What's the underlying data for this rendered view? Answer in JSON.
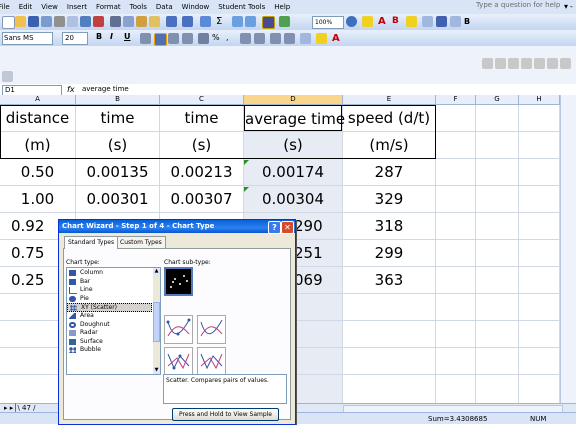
{
  "menu": [
    "File",
    "Edit",
    "View",
    "Insert",
    "Format",
    "Tools",
    "Data",
    "Window",
    "Student Tools",
    "Help"
  ],
  "help_box": "Type a question for help",
  "toolbar": {
    "zoom": "100%",
    "font_name": "Sans MS",
    "font_size": "20",
    "bold": "B",
    "italic": "I",
    "underline": "U"
  },
  "formula_bar": {
    "name_box": "D1",
    "fx": "fx",
    "content": "average time"
  },
  "columns": [
    "A",
    "B",
    "C",
    "D",
    "E",
    "F",
    "G",
    "H"
  ],
  "sheet": {
    "headers": [
      [
        "distance",
        "time",
        "time",
        "average time",
        "speed (d/t)"
      ],
      [
        "(m)",
        "(s)",
        "(s)",
        "(s)",
        "(m/s)"
      ]
    ],
    "rows": [
      [
        "0.50",
        "0.00135",
        "0.00213",
        "0.00174",
        "287"
      ],
      [
        "1.00",
        "0.00301",
        "0.00307",
        "0.00304",
        "329"
      ],
      [
        "0.92",
        "",
        "",
        "290",
        "318"
      ],
      [
        "0.75",
        "",
        "",
        "251",
        "299"
      ],
      [
        "0.25",
        "",
        "",
        "069",
        "363"
      ]
    ]
  },
  "sheet_tabs": {
    "nav": "▸ ▸│\\ 47 /"
  },
  "statusbar": {
    "sum": "Sum=3.4308685",
    "mode": "NUM"
  },
  "wizard": {
    "title": "Chart Wizard - Step 1 of 4 - Chart Type",
    "help_btn": "?",
    "close_btn": "✕",
    "tabs": [
      "Standard Types",
      "Custom Types"
    ],
    "chart_type_label": "Chart type:",
    "subtype_label": "Chart sub-type:",
    "chart_types": [
      "Column",
      "Bar",
      "Line",
      "Pie",
      "XY (Scatter)",
      "Area",
      "Doughnut",
      "Radar",
      "Surface",
      "Bubble"
    ],
    "selected_type": "XY (Scatter)",
    "description": "Scatter.  Compares pairs of values.",
    "press_button": "Press and Hold to View Sample"
  },
  "colors": {
    "accent": "#0a5fd8",
    "selected_column_header": "#f9d68b",
    "data_triangle": "#2e8b2e"
  }
}
